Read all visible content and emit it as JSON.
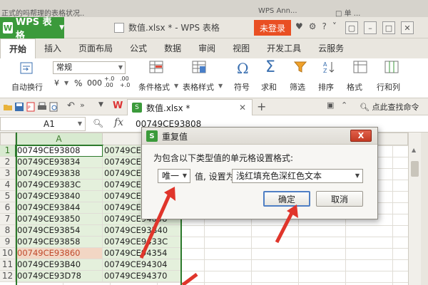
{
  "top_strip": {
    "left_text": "...",
    "right_text": "...",
    "right2_text": "..."
  },
  "titlebar": {
    "app_name": "WPS 表格",
    "doc_title": "数值.xlsx * - WPS 表格",
    "login": "未登录",
    "icons": [
      "shirt-icon",
      "help-icon",
      "chevron-icon",
      "restore-icon",
      "minimize-icon",
      "close-icon"
    ]
  },
  "tabs": [
    "开始",
    "插入",
    "页面布局",
    "公式",
    "数据",
    "审阅",
    "视图",
    "开发工具",
    "云服务"
  ],
  "ribbon": {
    "auto_wrap": "自动换行",
    "number_format": "常规",
    "percent": "%",
    "comma": "000",
    "cond_format": "条件格式",
    "table_style": "表格样式",
    "symbol": "符号",
    "sum": "求和",
    "filter": "筛选",
    "sort": "排序",
    "format": "格式",
    "row_col": "行和列"
  },
  "filetab": {
    "name": "数值.xlsx *",
    "logo": "W",
    "find_cmd": "点此查找命令"
  },
  "formula_bar": {
    "cell_ref": "A1",
    "fx": "fx",
    "value": "00749CE93808"
  },
  "grid": {
    "col_a": "A",
    "row_numbers": [
      "1",
      "2",
      "3",
      "4",
      "5",
      "6",
      "7",
      "8",
      "9",
      "10",
      "11",
      "12"
    ],
    "col_a_values": [
      "00749CE93808",
      "00749CE93834",
      "00749CE93838",
      "00749CE9383C",
      "00749CE93840",
      "00749CE93844",
      "00749CE93850",
      "00749CE93854",
      "00749CE93858",
      "00749CE93860",
      "00749CE93B40",
      "00749CE93D78"
    ],
    "col_b_values": [
      "00749CE9",
      "00749CE9",
      "00749CE9",
      "00749CE9",
      "00749CE9",
      "00749CE9",
      "00749CE94008",
      "00749CE93B40",
      "00749CE9433C",
      "00749CE94354",
      "00749CE94304",
      "00749CE94370"
    ]
  },
  "dialog": {
    "logo": "S",
    "title": "重复值",
    "close": "X",
    "prompt": "为包含以下类型值的单元格设置格式:",
    "type_select": "唯一",
    "mid_text": "值, 设置为",
    "style_select": "浅红填充色深红色文本",
    "ok": "确定",
    "cancel": "取消"
  },
  "colors": {
    "wps_green": "#3b9a3b",
    "login_orange": "#e94f23",
    "dup_fill": "#f2d6c4",
    "dup_text": "#c0492b",
    "annotation_red": "#e0352b"
  }
}
